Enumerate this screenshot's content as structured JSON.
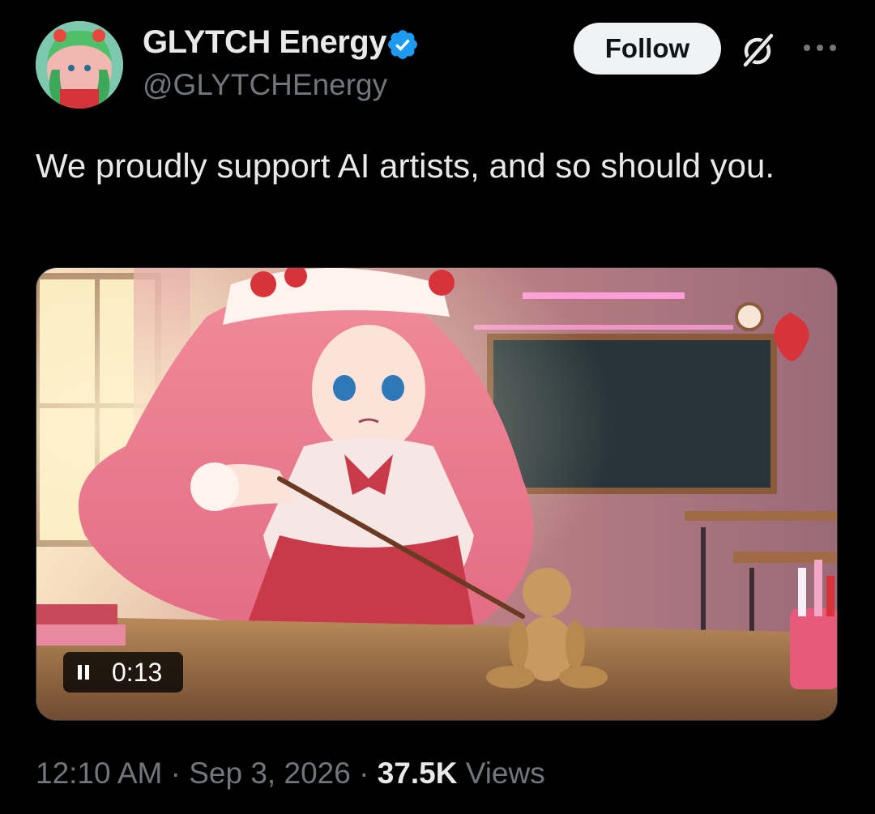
{
  "author": {
    "display_name": "GLYTCH Energy",
    "handle": "@GLYTCHEnergy",
    "verified": true,
    "verified_color": "#1d9bf0"
  },
  "actions": {
    "follow_label": "Follow",
    "grok_icon": "grok-icon",
    "more_icon": "more-icon"
  },
  "tweet": {
    "text": "We proudly support AI artists, and so should you."
  },
  "media": {
    "type": "video",
    "duration": "0:13",
    "state": "playing"
  },
  "meta": {
    "time": "12:10 AM",
    "separator": "·",
    "date": "Sep 3, 2026",
    "views_count": "37.5K",
    "views_label": "Views"
  },
  "colors": {
    "background": "#000000",
    "primary_text": "#e7e9ea",
    "secondary_text": "#71767b",
    "follow_bg": "#eff3f4",
    "follow_text": "#0f1419"
  }
}
